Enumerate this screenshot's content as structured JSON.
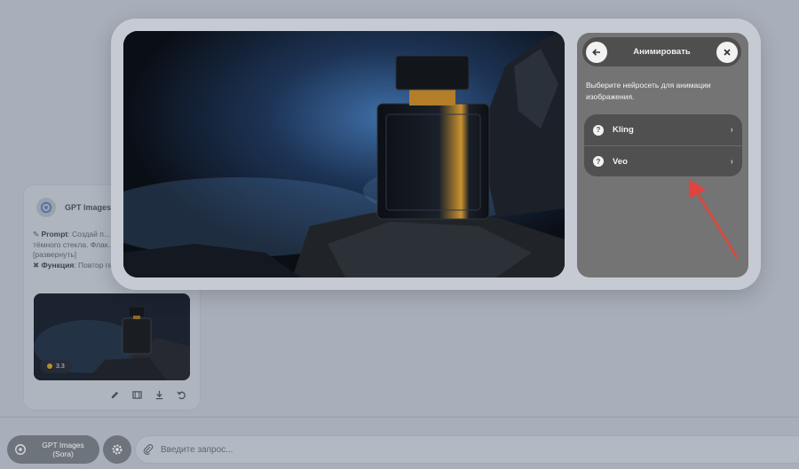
{
  "card": {
    "model_name": "GPT Images (S",
    "prompt_label": "Prompt",
    "prompt_text": "Создай п... рекламный кадр фла... тёмного стекла. Флак...",
    "expand_link": "[развернуть]",
    "function_label": "Функция",
    "function_value": "Повтор ге...",
    "badge_value": "3.3"
  },
  "modal": {
    "title": "Анимировать",
    "description": "Выберите нейросеть для анимации изображения.",
    "options": [
      {
        "label": "Kling",
        "icon": "question-icon"
      },
      {
        "label": "Veo",
        "icon": "question-icon"
      }
    ]
  },
  "bottom_bar": {
    "model_label": "GPT Images (Sora)",
    "input_placeholder": "Введите запрос..."
  },
  "colors": {
    "backdrop": "#a8afba",
    "panel": "#747474",
    "panel_dark": "#505050",
    "annotation_arrow": "#e0443c"
  }
}
